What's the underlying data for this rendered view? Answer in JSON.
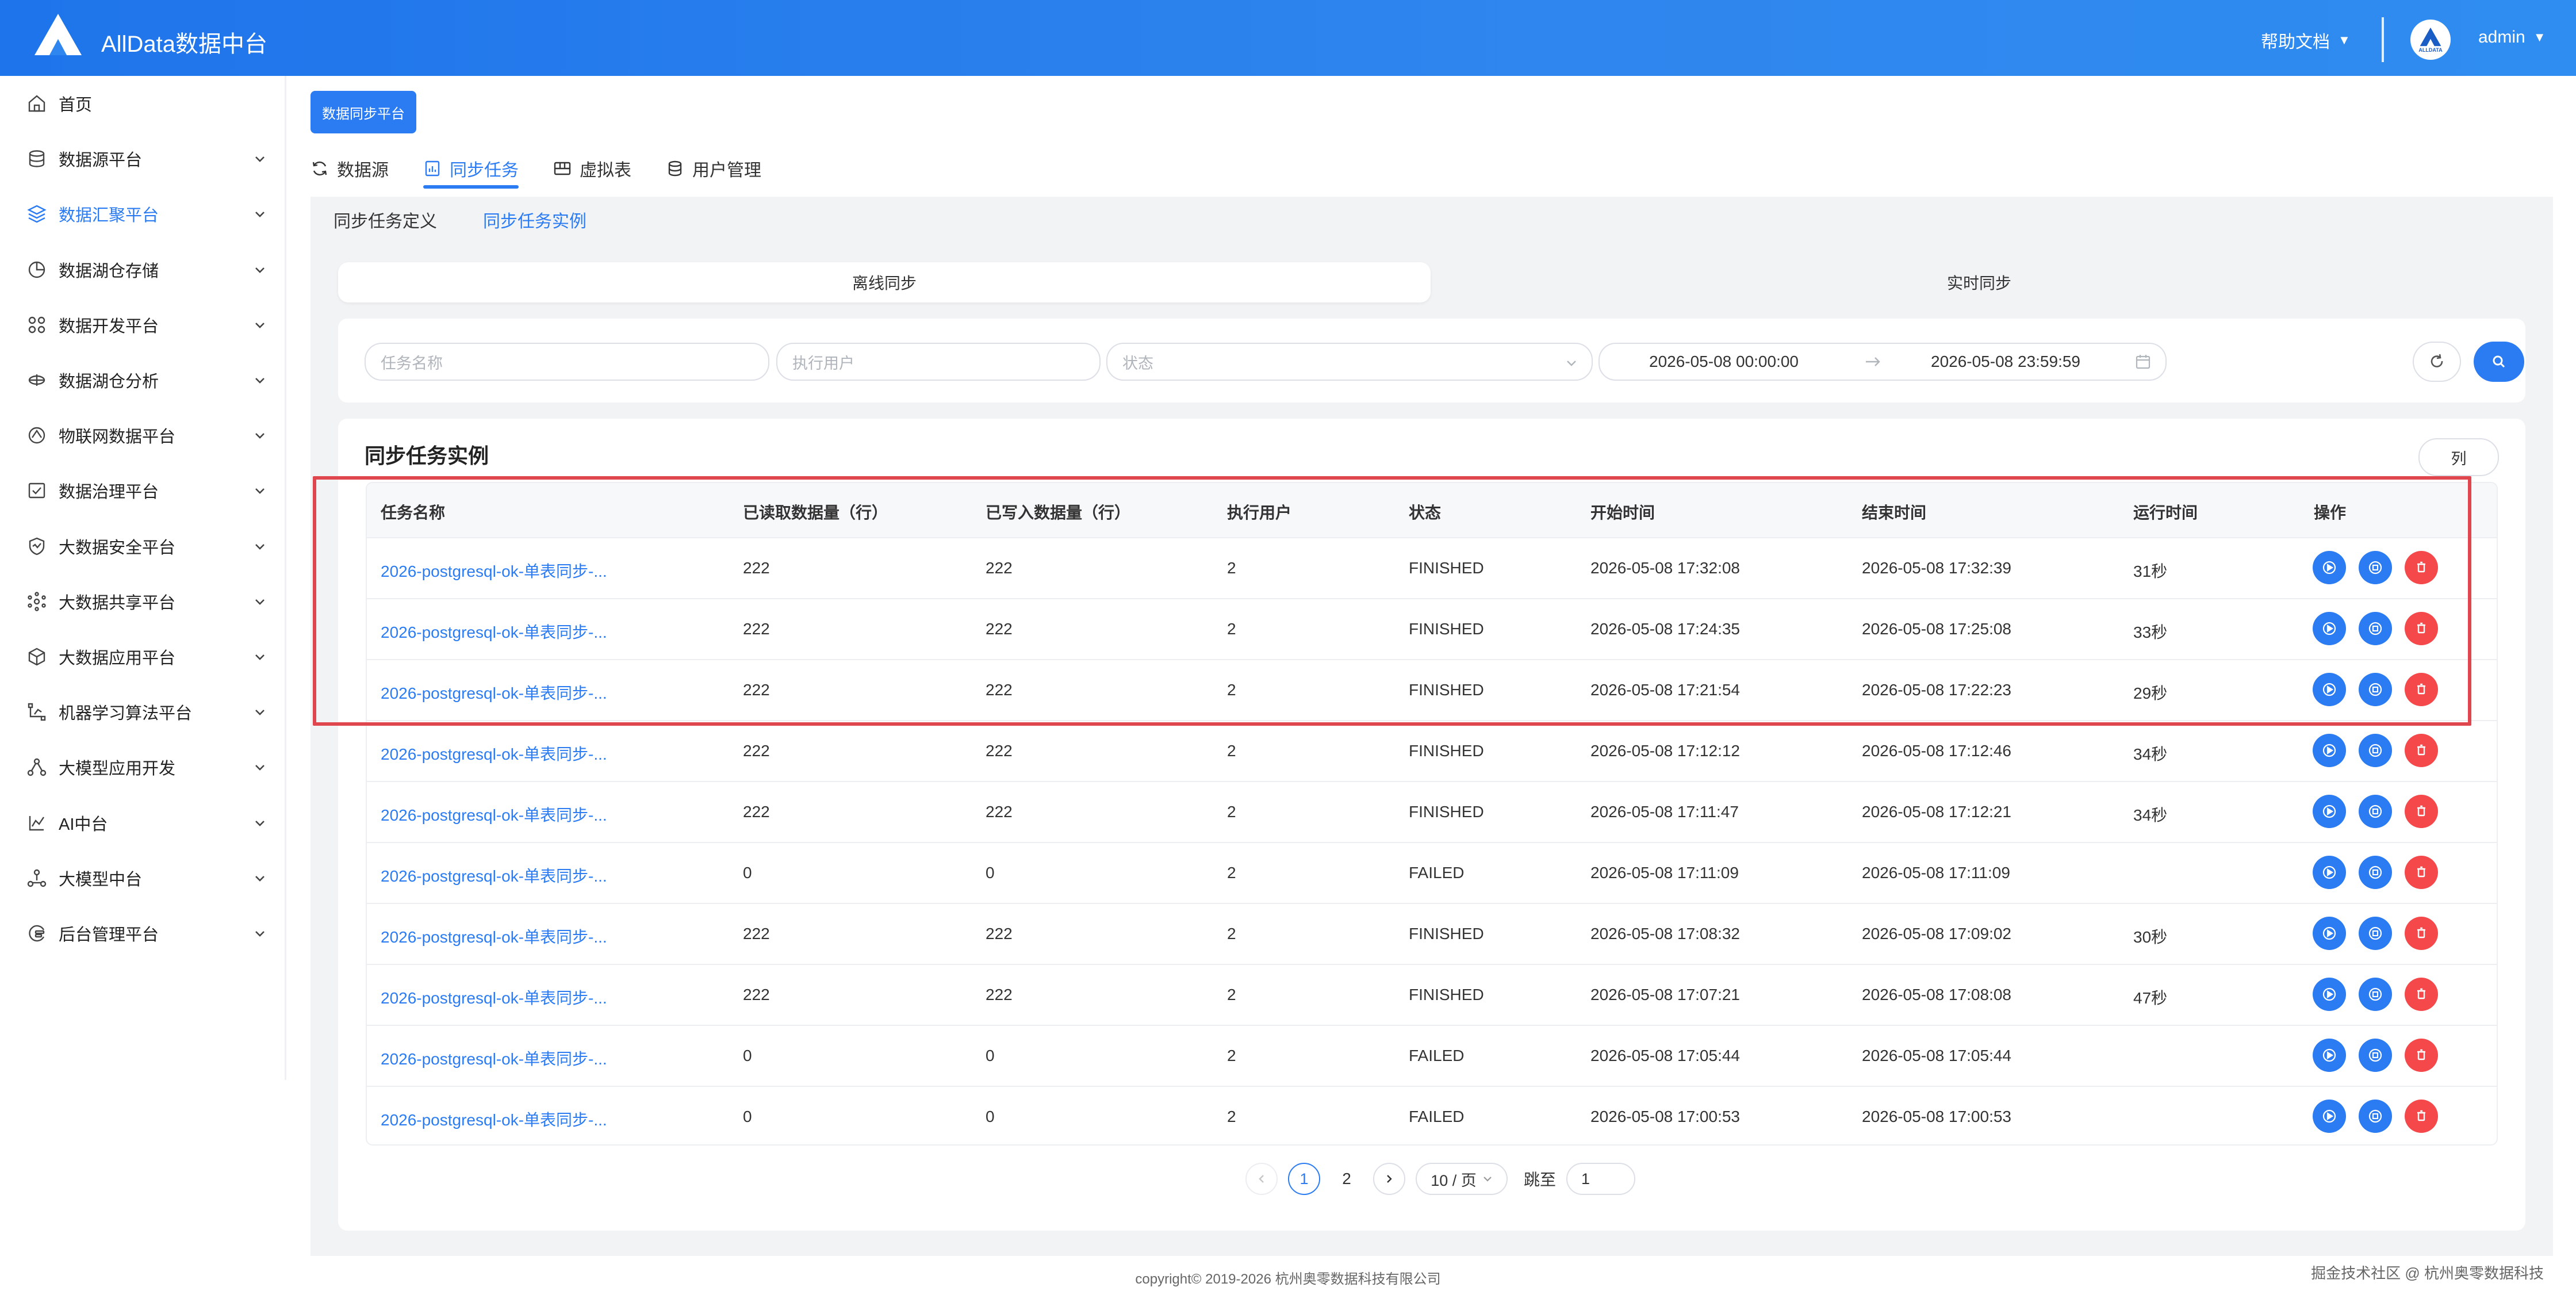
{
  "header": {
    "app_title": "AllData数据中台",
    "help_label": "帮助文档",
    "avatar_text": "ALLDATA",
    "user_name": "admin"
  },
  "colors": {
    "primary": "#2b7cf2",
    "danger": "#f5484a",
    "highlight": "#e0464e"
  },
  "sidebar": {
    "items": [
      {
        "label": "首页",
        "icon": "home-icon",
        "has_children": false
      },
      {
        "label": "数据源平台",
        "icon": "database-icon",
        "has_children": true
      },
      {
        "label": "数据汇聚平台",
        "icon": "layers-icon",
        "has_children": true,
        "active": true
      },
      {
        "label": "数据湖仓存储",
        "icon": "pie-chart-icon",
        "has_children": true
      },
      {
        "label": "数据开发平台",
        "icon": "grid-icon",
        "has_children": true
      },
      {
        "label": "数据湖仓分析",
        "icon": "analysis-icon",
        "has_children": true
      },
      {
        "label": "物联网数据平台",
        "icon": "iot-icon",
        "has_children": true
      },
      {
        "label": "数据治理平台",
        "icon": "governance-icon",
        "has_children": true
      },
      {
        "label": "大数据安全平台",
        "icon": "shield-icon",
        "has_children": true
      },
      {
        "label": "大数据共享平台",
        "icon": "share-icon",
        "has_children": true
      },
      {
        "label": "大数据应用平台",
        "icon": "cube-icon",
        "has_children": true
      },
      {
        "label": "机器学习算法平台",
        "icon": "ml-icon",
        "has_children": true
      },
      {
        "label": "大模型应用开发",
        "icon": "network-icon",
        "has_children": true
      },
      {
        "label": "AI中台",
        "icon": "ai-icon",
        "has_children": true
      },
      {
        "label": "大模型中台",
        "icon": "model-icon",
        "has_children": true
      },
      {
        "label": "后台管理平台",
        "icon": "settings-icon",
        "has_children": true
      }
    ]
  },
  "main": {
    "platform_button": "数据同步平台",
    "top_tabs": [
      {
        "label": "数据源",
        "icon": "refresh-icon"
      },
      {
        "label": "同步任务",
        "icon": "task-icon",
        "active": true
      },
      {
        "label": "虚拟表",
        "icon": "table-icon"
      },
      {
        "label": "用户管理",
        "icon": "user-db-icon"
      }
    ],
    "sub_tabs": [
      {
        "label": "同步任务定义"
      },
      {
        "label": "同步任务实例",
        "active": true
      }
    ],
    "segments": [
      {
        "label": "离线同步",
        "active": true
      },
      {
        "label": "实时同步"
      }
    ],
    "filters": {
      "task_name_placeholder": "任务名称",
      "exec_user_placeholder": "执行用户",
      "status_placeholder": "状态",
      "date_start": "2026-05-08 00:00:00",
      "date_end": "2026-05-08 23:59:59"
    },
    "card_title": "同步任务实例",
    "columns_button": "列",
    "table": {
      "headers": [
        "任务名称",
        "已读取数据量（行）",
        "已写入数据量（行）",
        "执行用户",
        "状态",
        "开始时间",
        "结束时间",
        "运行时间",
        "操作"
      ],
      "rows": [
        {
          "name": "2026-postgresql-ok-单表同步-...",
          "read": "222",
          "written": "222",
          "user": "2",
          "status": "FINISHED",
          "start": "2026-05-08 17:32:08",
          "end": "2026-05-08 17:32:39",
          "duration": "31秒"
        },
        {
          "name": "2026-postgresql-ok-单表同步-...",
          "read": "222",
          "written": "222",
          "user": "2",
          "status": "FINISHED",
          "start": "2026-05-08 17:24:35",
          "end": "2026-05-08 17:25:08",
          "duration": "33秒"
        },
        {
          "name": "2026-postgresql-ok-单表同步-...",
          "read": "222",
          "written": "222",
          "user": "2",
          "status": "FINISHED",
          "start": "2026-05-08 17:21:54",
          "end": "2026-05-08 17:22:23",
          "duration": "29秒"
        },
        {
          "name": "2026-postgresql-ok-单表同步-...",
          "read": "222",
          "written": "222",
          "user": "2",
          "status": "FINISHED",
          "start": "2026-05-08 17:12:12",
          "end": "2026-05-08 17:12:46",
          "duration": "34秒"
        },
        {
          "name": "2026-postgresql-ok-单表同步-...",
          "read": "222",
          "written": "222",
          "user": "2",
          "status": "FINISHED",
          "start": "2026-05-08 17:11:47",
          "end": "2026-05-08 17:12:21",
          "duration": "34秒"
        },
        {
          "name": "2026-postgresql-ok-单表同步-...",
          "read": "0",
          "written": "0",
          "user": "2",
          "status": "FAILED",
          "start": "2026-05-08 17:11:09",
          "end": "2026-05-08 17:11:09",
          "duration": ""
        },
        {
          "name": "2026-postgresql-ok-单表同步-...",
          "read": "222",
          "written": "222",
          "user": "2",
          "status": "FINISHED",
          "start": "2026-05-08 17:08:32",
          "end": "2026-05-08 17:09:02",
          "duration": "30秒"
        },
        {
          "name": "2026-postgresql-ok-单表同步-...",
          "read": "222",
          "written": "222",
          "user": "2",
          "status": "FINISHED",
          "start": "2026-05-08 17:07:21",
          "end": "2026-05-08 17:08:08",
          "duration": "47秒"
        },
        {
          "name": "2026-postgresql-ok-单表同步-...",
          "read": "0",
          "written": "0",
          "user": "2",
          "status": "FAILED",
          "start": "2026-05-08 17:05:44",
          "end": "2026-05-08 17:05:44",
          "duration": ""
        },
        {
          "name": "2026-postgresql-ok-单表同步-...",
          "read": "0",
          "written": "0",
          "user": "2",
          "status": "FAILED",
          "start": "2026-05-08 17:00:53",
          "end": "2026-05-08 17:00:53",
          "duration": ""
        }
      ]
    },
    "pagination": {
      "pages": [
        "1",
        "2"
      ],
      "current": "1",
      "page_size": "10 / 页",
      "jump_label": "跳至",
      "jump_value": "1"
    }
  },
  "footer": {
    "copyright": "copyright© 2019-2026 杭州奥零数据科技有限公司",
    "watermark": "掘金技术社区 @ 杭州奥零数据科技"
  }
}
